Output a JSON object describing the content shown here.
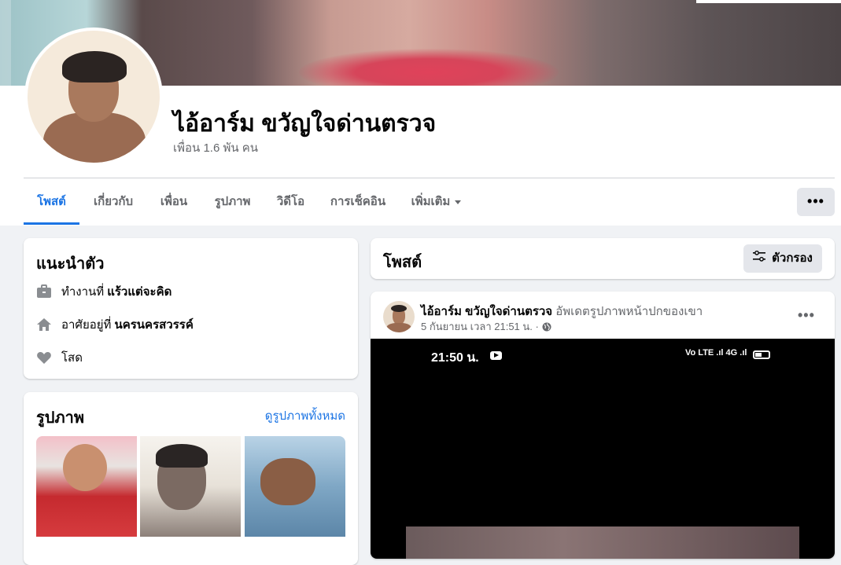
{
  "profile": {
    "name": "ไอ้อาร์ม ขวัญใจด่านตรวจ",
    "friends": "เพื่อน 1.6 พัน คน"
  },
  "tabs": [
    {
      "label": "โพสต์",
      "active": true
    },
    {
      "label": "เกี่ยวกับ",
      "active": false
    },
    {
      "label": "เพื่อน",
      "active": false
    },
    {
      "label": "รูปภาพ",
      "active": false
    },
    {
      "label": "วิดีโอ",
      "active": false
    },
    {
      "label": "การเช็คอิน",
      "active": false
    },
    {
      "label": "เพิ่มเติม",
      "active": false
    }
  ],
  "more_button_label": "•••",
  "intro": {
    "title": "แนะนำตัว",
    "work_prefix": "ทำงานที่",
    "work_value": "แร้วแต่จะคิด",
    "home_prefix": "อาศัยอยู่ที่",
    "home_value": "นครนครสวรรค์",
    "relationship": "โสด"
  },
  "photos": {
    "title": "รูปภาพ",
    "see_all": "ดูรูปภาพทั้งหมด"
  },
  "posts": {
    "title": "โพสต์",
    "filter_label": "ตัวกรอง"
  },
  "post": {
    "author": "ไอ้อาร์ม ขวัญใจด่านตรวจ",
    "action": "อัพเดตรูปภาพหน้าปกของเขา",
    "timestamp": "5 กันยายน เวลา 21:51 น.",
    "separator": "·",
    "menu_label": "•••",
    "phone_time": "21:50 น.",
    "status_icons": "Vo LTE .ıl 4G .ıl"
  },
  "colors": {
    "accent": "#1b74e4",
    "secondary_text": "#65676b",
    "background": "#f0f2f5"
  },
  "icons": [
    "briefcase-icon",
    "home-icon",
    "heart-icon",
    "filter-icon",
    "globe-icon",
    "caret-down-icon",
    "youtube-icon",
    "battery-icon"
  ]
}
